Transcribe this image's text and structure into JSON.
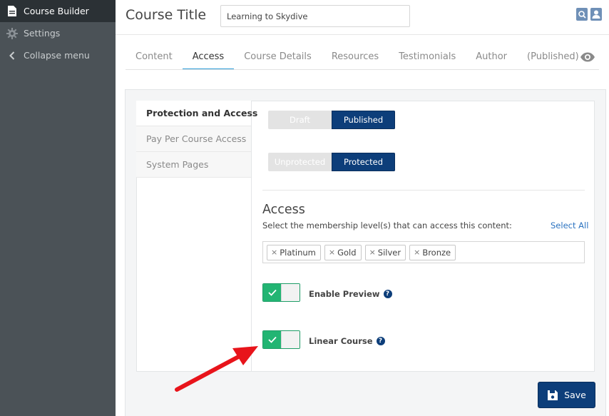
{
  "sidebar": {
    "items": [
      {
        "label": "Course Builder",
        "icon": "document-icon"
      },
      {
        "label": "Settings",
        "icon": "gear-icon"
      },
      {
        "label": "Collapse menu",
        "icon": "chevron-left-icon"
      }
    ]
  },
  "header": {
    "title": "Course Title",
    "title_input_value": "Learning to Skydive"
  },
  "tabs": [
    {
      "label": "Content"
    },
    {
      "label": "Access"
    },
    {
      "label": "Course Details"
    },
    {
      "label": "Resources"
    },
    {
      "label": "Testimonials"
    },
    {
      "label": "Author"
    },
    {
      "label": "(Published)"
    }
  ],
  "subnav": [
    {
      "label": "Protection and Access"
    },
    {
      "label": "Pay Per Course Access"
    },
    {
      "label": "System Pages"
    }
  ],
  "status_toggle": {
    "off": "Draft",
    "on": "Published"
  },
  "protection_toggle": {
    "off": "Unprotected",
    "on": "Protected"
  },
  "access": {
    "title": "Access",
    "description": "Select the membership level(s) that can access this content:",
    "select_all": "Select All",
    "levels": [
      "Platinum",
      "Gold",
      "Silver",
      "Bronze"
    ],
    "remove_glyph": "×"
  },
  "enable_preview": {
    "label": "Enable Preview",
    "help": "?"
  },
  "linear_course": {
    "label": "Linear Course",
    "help": "?"
  },
  "save_label": "Save",
  "colors": {
    "sidebar": "#4b5257",
    "sidebar_active": "#2b3135",
    "primary": "#0d3e7a",
    "toggle_green": "#22b573",
    "link": "#2a72c0",
    "tab_underline": "#2a9ad6",
    "arrow": "#e8141b"
  }
}
